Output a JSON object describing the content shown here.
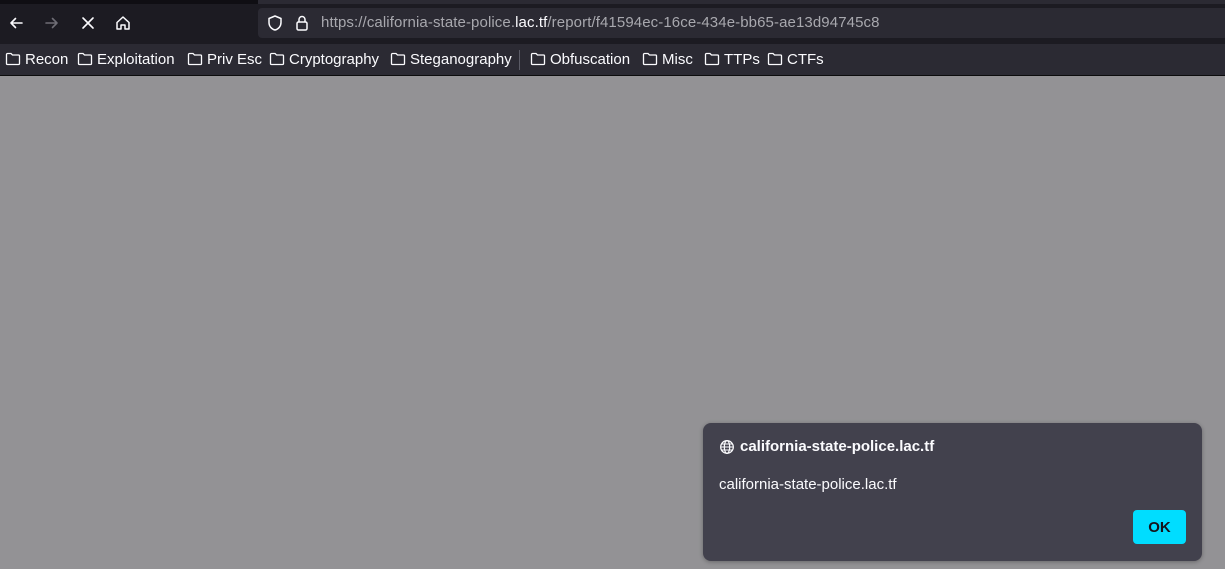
{
  "browser": {
    "url_prefix": "https://california-state-police.",
    "url_host": "lac.tf",
    "url_path": "/report/f41594ec-16ce-434e-bb65-ae13d94745c8",
    "icons": {
      "back": "arrow-left-icon",
      "forward": "arrow-right-icon",
      "stop": "close-icon",
      "home": "home-icon",
      "tracking": "shield-icon",
      "secure": "lock-icon"
    }
  },
  "bookmarks": [
    {
      "label": "Recon",
      "icon": "folder-icon"
    },
    {
      "label": "Exploitation",
      "icon": "folder-icon"
    },
    {
      "label": "Priv Esc",
      "icon": "folder-icon"
    },
    {
      "label": "Cryptography",
      "icon": "folder-icon"
    },
    {
      "label": "Steganography",
      "icon": "folder-icon"
    },
    {
      "label": "Obfuscation",
      "icon": "folder-icon"
    },
    {
      "label": "Misc",
      "icon": "folder-icon"
    },
    {
      "label": "TTPs",
      "icon": "folder-icon"
    },
    {
      "label": "CTFs",
      "icon": "folder-icon"
    }
  ],
  "dialog": {
    "origin": "california-state-police.lac.tf",
    "message": "california-state-police.lac.tf",
    "ok_label": "OK",
    "icon": "globe-icon"
  },
  "colors": {
    "page_overlay": "#939295",
    "toolbar": "#1c1b22",
    "dialog_bg": "#42414d",
    "accent": "#00ddff"
  }
}
